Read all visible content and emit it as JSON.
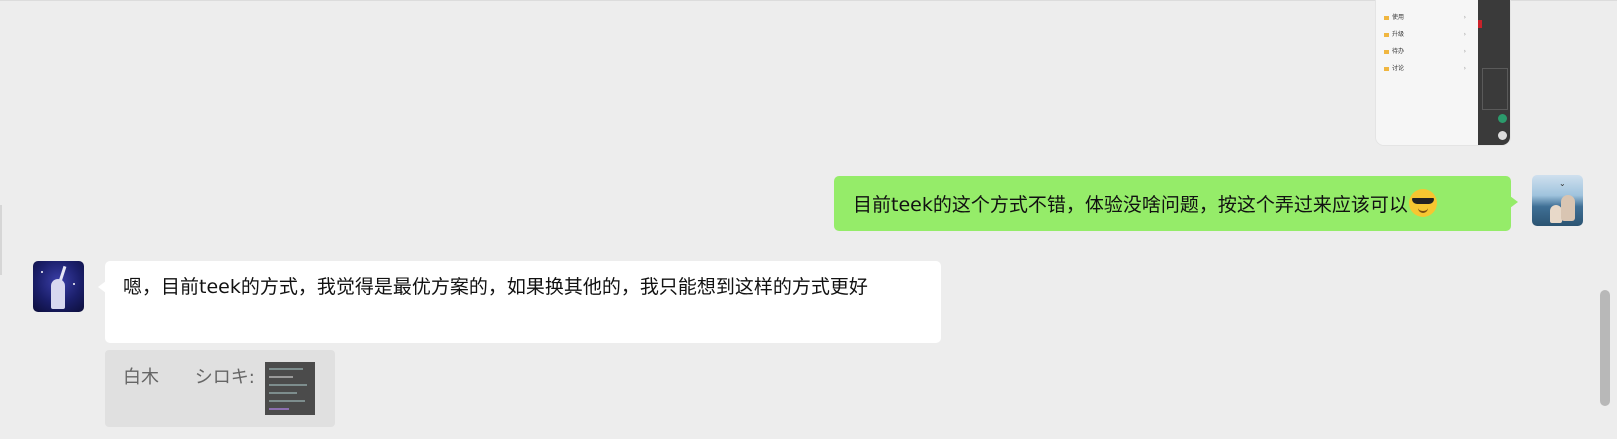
{
  "screenshot_menu": {
    "items": [
      {
        "label": "使用",
        "arrow": "›"
      },
      {
        "label": "升级",
        "arrow": "›"
      },
      {
        "label": "待办",
        "arrow": "›"
      },
      {
        "label": "讨论",
        "arrow": "›"
      }
    ]
  },
  "messages": [
    {
      "sender": "me",
      "text": "目前teek的这个方式不错，体验没啥问题，按这个弄过来应该可以",
      "emoji": "smiling-face-with-sunglasses"
    },
    {
      "sender": "other",
      "text": "嗯，目前teek的方式，我觉得是最优方案的，如果换其他的，我只能想到这样的方式更好"
    }
  ],
  "quote": {
    "text": "白木 シロキ:"
  },
  "colors": {
    "background": "#ededed",
    "my_bubble": "#95ec69",
    "their_bubble": "#ffffff",
    "quote_bg": "#e0e0e0"
  }
}
